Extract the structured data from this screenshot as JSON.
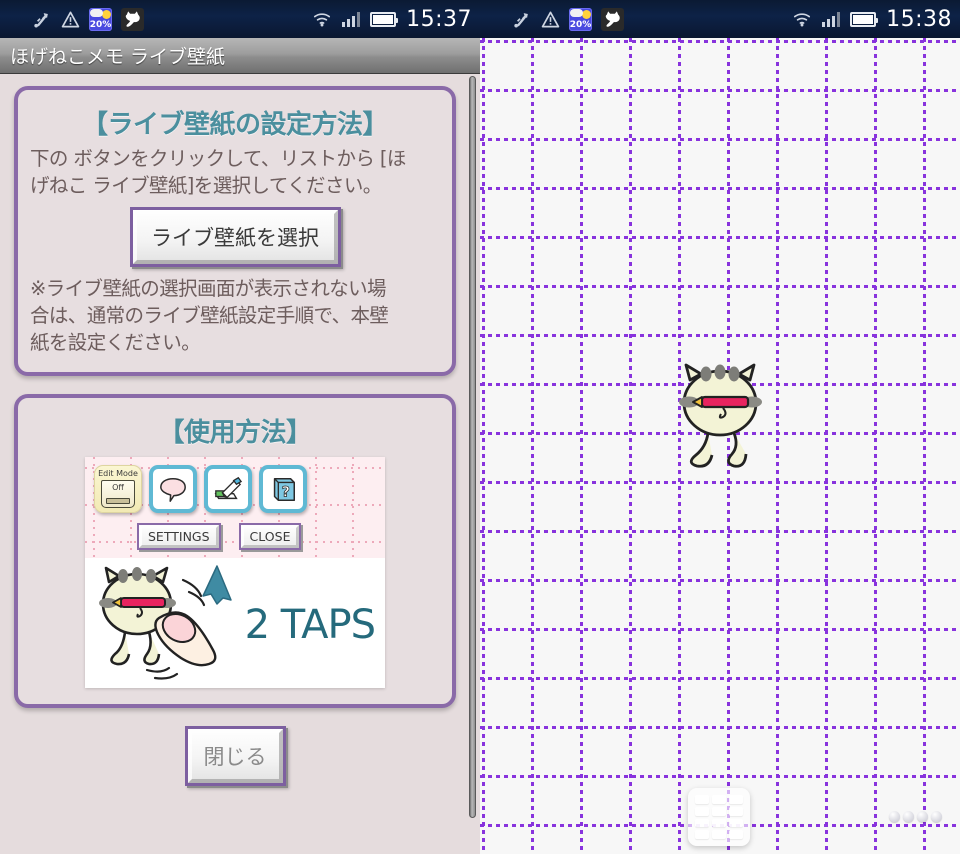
{
  "left_pane": {
    "statusbar": {
      "icons_left": [
        "usb-debug-icon",
        "warning-icon",
        "weather-widget-icon",
        "cat-app-icon"
      ],
      "weather_percent": "20%",
      "icons_right": [
        "wifi-icon",
        "signal-icon",
        "battery-icon"
      ],
      "clock": "15:37"
    },
    "titlebar": {
      "title": "ほげねこメモ ライブ壁紙"
    },
    "cards": [
      {
        "heading": "【ライブ壁紙の設定方法】",
        "paragraphs": [
          "下の ボタンをクリックして、リストから [ほ",
          "げねこ ライブ壁紙]を選択してください。"
        ],
        "button_label": "ライブ壁紙を選択",
        "note": [
          "※ライブ壁紙の選択画面が表示されない場",
          "合は、通常のライブ壁紙設定手順で、本壁",
          "紙を設定ください。"
        ]
      },
      {
        "heading": "【使用方法】",
        "screenshot": {
          "edit_mode_label": "Edit Mode",
          "edit_mode_value": "Off",
          "icon_tiles": [
            "speech-bubble-icon",
            "edit-note-icon",
            "help-book-icon"
          ],
          "settings_button": "SETTINGS",
          "close_button": "CLOSE",
          "taps_label": "2 TAPS"
        }
      }
    ],
    "bottom_button_label": "閉じる"
  },
  "right_pane": {
    "statusbar": {
      "weather_percent": "20%",
      "clock": "15:38"
    },
    "wallpaper": {
      "name": "hogeneko-live-wallpaper",
      "background_color": "#f7f7f7",
      "grid_color": "#8833dd",
      "grid_spacing_px": 49
    },
    "dock": {
      "app_drawer": "app-drawer-icon",
      "page_indicator_count": 4
    }
  },
  "colors": {
    "card_border": "#8a6aa8",
    "card_bg": "#e7dee0",
    "heading_teal": "#4b8f9e",
    "body_text": "#6d5d5d",
    "taps_text": "#256a7c",
    "statusbar_bg": "#0d2247"
  }
}
